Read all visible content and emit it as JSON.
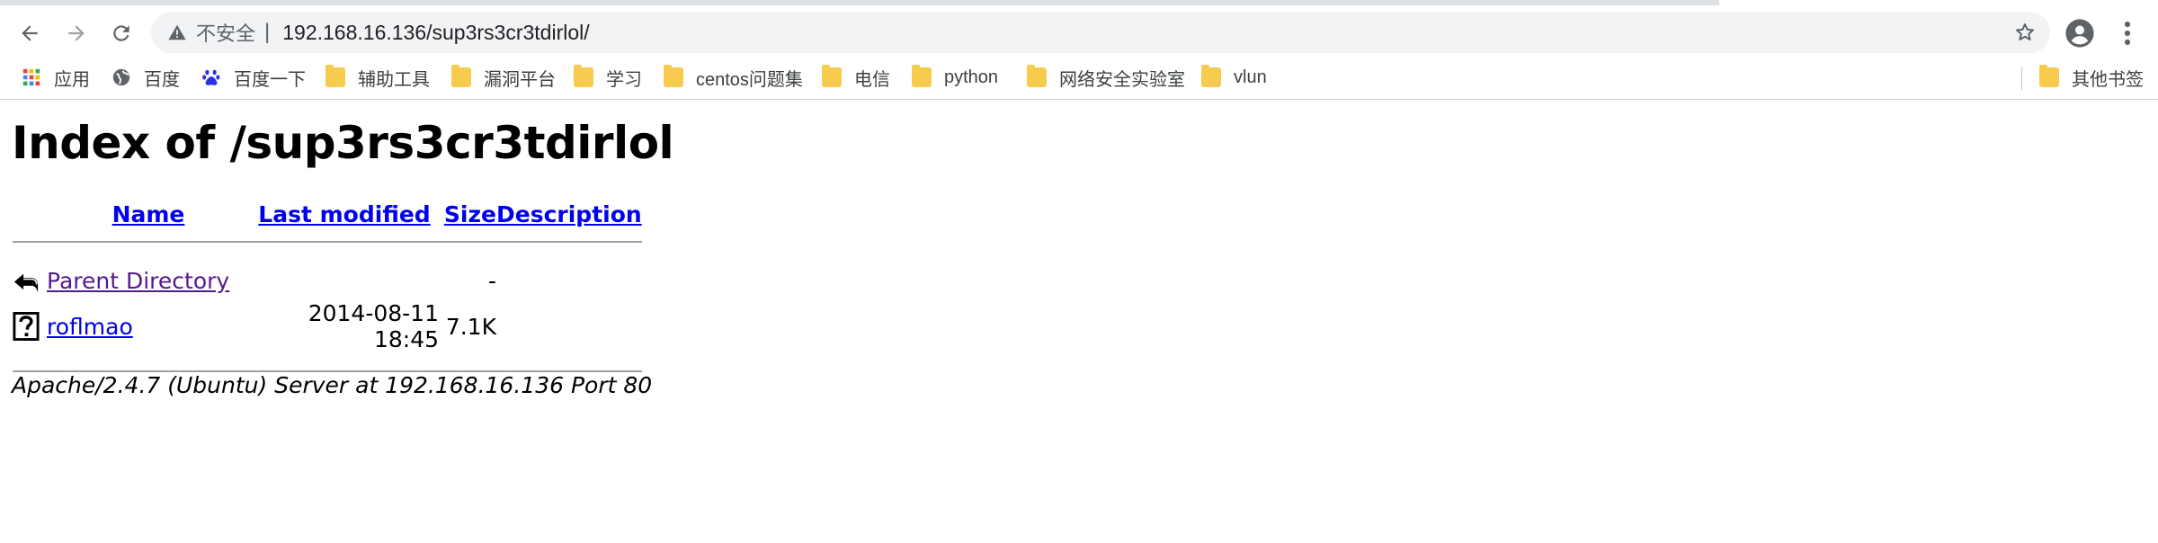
{
  "browser": {
    "insecure_label": "不安全",
    "separator": "|",
    "url": "192.168.16.136/sup3rs3cr3tdirlol/",
    "back_icon": "arrow-left-icon",
    "forward_icon": "arrow-right-icon",
    "reload_icon": "reload-icon"
  },
  "bookmarks": [
    {
      "label": "应用",
      "icon": "apps-grid-icon"
    },
    {
      "label": "百度",
      "icon": "globe-icon"
    },
    {
      "label": "百度一下",
      "icon": "baidu-paw-icon"
    },
    {
      "label": "辅助工具",
      "icon": "folder-icon"
    },
    {
      "label": "漏洞平台",
      "icon": "folder-icon"
    },
    {
      "label": "学习",
      "icon": "folder-icon"
    },
    {
      "label": "centos问题集",
      "icon": "folder-icon"
    },
    {
      "label": "电信",
      "icon": "folder-icon"
    },
    {
      "label": "python",
      "icon": "folder-icon"
    },
    {
      "label": "网络安全实验室",
      "icon": "folder-icon"
    },
    {
      "label": "vlun",
      "icon": "folder-icon"
    }
  ],
  "other_bookmarks": "其他书签",
  "page": {
    "title": "Index of /sup3rs3cr3tdirlol",
    "columns": {
      "name": "Name",
      "last_modified": "Last modified",
      "size": "Size",
      "description": "Description"
    },
    "rows": [
      {
        "name": "Parent Directory",
        "modified": "",
        "size": "-",
        "description": "",
        "icon": "back-arrow-icon"
      },
      {
        "name": "roflmao",
        "modified": "2014-08-11 18:45",
        "size": "7.1K",
        "description": "",
        "icon": "unknown-file-icon"
      }
    ],
    "footer": "Apache/2.4.7 (Ubuntu) Server at 192.168.16.136 Port 80"
  }
}
